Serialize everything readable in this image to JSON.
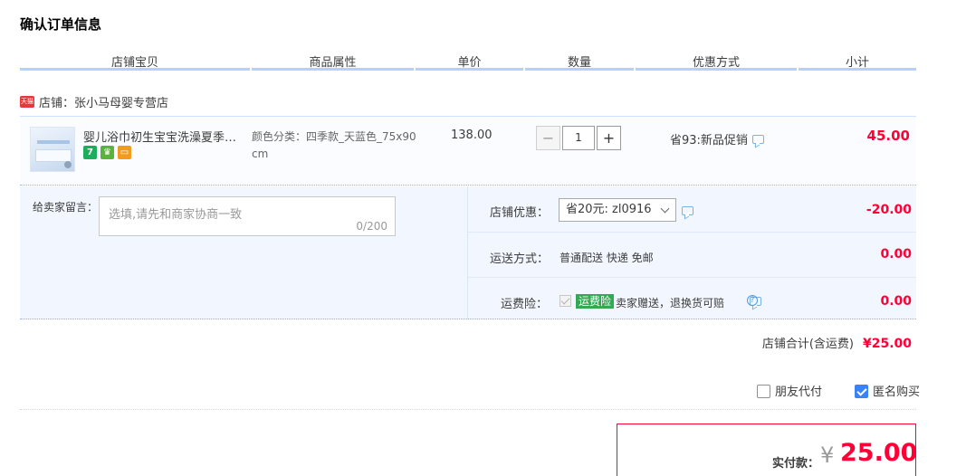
{
  "title": "确认订单信息",
  "columns": [
    "店铺宝贝",
    "商品属性",
    "单价",
    "数量",
    "优惠方式",
    "小计"
  ],
  "shop": {
    "badge": "天猫",
    "label": "店铺：张小马母婴专营店"
  },
  "item": {
    "name": "婴儿浴巾初生宝宝洗澡夏季薄款…",
    "badges": [
      "7",
      "♛",
      "▭"
    ],
    "attribute": "颜色分类：四季款_天蓝色_75x90cm",
    "price": "138.00",
    "quantity": "1",
    "qty_minus": "−",
    "qty_plus": "+",
    "promo": "省93:新品促销",
    "subtotal": "45.00"
  },
  "memo": {
    "label": "给卖家留言：",
    "placeholder": "选填,请先和商家协商一致",
    "count": "0/200"
  },
  "discount": {
    "label": "店铺优惠：",
    "selected": "省20元: zl0916",
    "value": "-20.00"
  },
  "shipping": {
    "label": "运送方式：",
    "method": "普通配送 快递 免邮",
    "value": "0.00"
  },
  "insurance": {
    "label": "运费险：",
    "tag": "运费险",
    "text": "卖家赠送，退换货可赔",
    "help": "?",
    "value": "0.00"
  },
  "shop_total": {
    "label": "店铺合计(含运费)",
    "value": "¥25.00"
  },
  "options": {
    "friend_pay": "朋友代付",
    "friend_pay_checked": false,
    "anonymous": "匿名购买",
    "anonymous_checked": true
  },
  "payment": {
    "label": "实付款：",
    "currency": "¥",
    "amount": "25.00"
  },
  "colors": {
    "accent": "#ff0036",
    "header_line": "#b2d1ff",
    "detail_bg": "#f2f7ff"
  }
}
